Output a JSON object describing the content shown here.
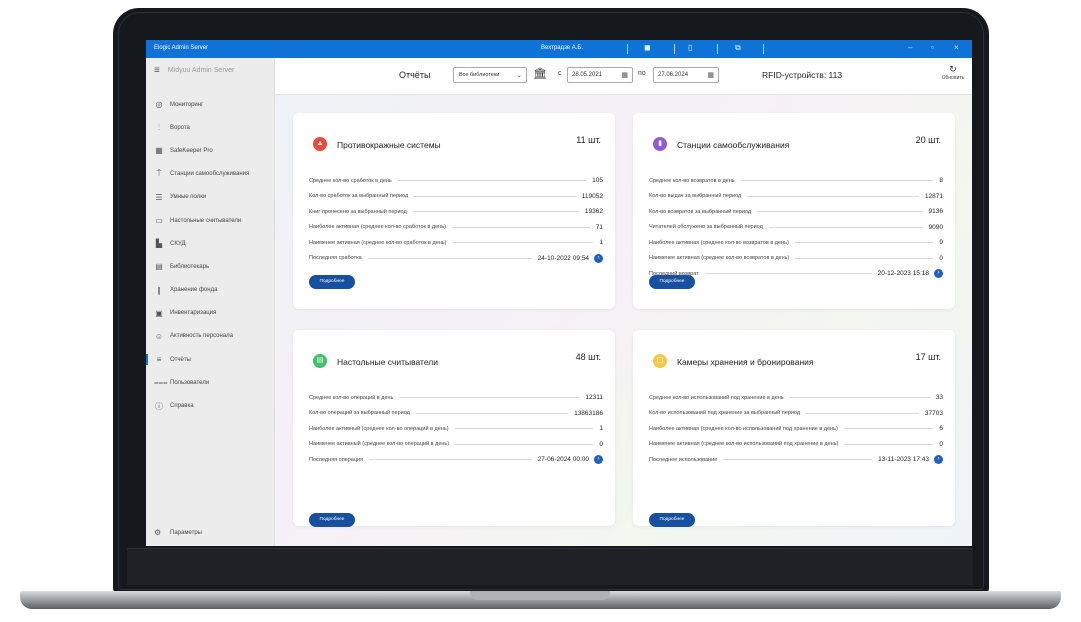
{
  "titlebar": {
    "app_title": "Elogic Admin Server",
    "user": "Вехтрадзе А.Б."
  },
  "sidebar": {
    "header": "Midyuu Admin Server",
    "items": [
      {
        "icon": "monitor-icon",
        "label": "Мониторинг"
      },
      {
        "icon": "gate-icon",
        "label": "Ворота"
      },
      {
        "icon": "safe-icon",
        "label": "SafeKeeper Pro"
      },
      {
        "icon": "kiosk-icon",
        "label": "Станции самообслуживания"
      },
      {
        "icon": "shelf-icon",
        "label": "Умные полки"
      },
      {
        "icon": "reader-icon",
        "label": "Настольные считыватели"
      },
      {
        "icon": "access-icon",
        "label": "СКУД"
      },
      {
        "icon": "librarian-icon",
        "label": "Библиотекарь"
      },
      {
        "icon": "storage-icon",
        "label": "Хранение фонда"
      },
      {
        "icon": "inventory-icon",
        "label": "Инвентаризация"
      },
      {
        "icon": "activity-icon",
        "label": "Активность персонала"
      },
      {
        "icon": "reports-icon",
        "label": "Отчёты"
      },
      {
        "icon": "users-icon",
        "label": "Пользователи"
      },
      {
        "icon": "help-icon",
        "label": "Справка"
      }
    ],
    "settings": "Параметры"
  },
  "toolbar": {
    "title": "Отчёты",
    "library_select": "Все библиотеки",
    "from_label": "с",
    "date_from": "28.05.2021",
    "to_label": "по",
    "date_to": "27.06.2024",
    "rfid": "RFID-устройств: 113",
    "refresh": "Обновить"
  },
  "cards": [
    {
      "title": "Противокражные системы",
      "count": "11 шт.",
      "color": "#e74c3c",
      "rows": [
        {
          "k": "Среднее кол-во сработок в день",
          "v": "105"
        },
        {
          "k": "Кол-во сработок за выбранный период",
          "v": "119052"
        },
        {
          "k": "Книг пронесено за выбранный период",
          "v": "19362"
        },
        {
          "k": "Наиболее активная (среднее кол-во сработок в день)",
          "v": "71"
        },
        {
          "k": "Наименее активная (среднее кол-во сработок в день)",
          "v": "1"
        },
        {
          "k": "Последняя сработка",
          "v": "24-10-2022 09:54"
        }
      ],
      "button": "Подробнее"
    },
    {
      "title": "Станции самообслуживания",
      "count": "20 шт.",
      "color": "#8e5bd6",
      "rows": [
        {
          "k": "Среднее кол-во возвратов в день",
          "v": "8"
        },
        {
          "k": "Кол-во выдач за выбранный период",
          "v": "12871"
        },
        {
          "k": "Кол-во возвратов за выбранный период",
          "v": "9136"
        },
        {
          "k": "Читателей обслужено за выбранный период",
          "v": "9090"
        },
        {
          "k": "Наиболее активная (среднее кол-во возвратов в день)",
          "v": "9"
        },
        {
          "k": "Наименее активная (среднее кол-во возвратов в день)",
          "v": "0"
        },
        {
          "k": "Последний возврат",
          "v": "20-12-2023 15:18"
        }
      ],
      "button": "Подробнее"
    },
    {
      "title": "Настольные считыватели",
      "count": "48 шт.",
      "color": "#43c06b",
      "rows": [
        {
          "k": "Среднее кол-во операций в день",
          "v": "12311"
        },
        {
          "k": "Кол-во операций за выбранный период",
          "v": "13863186"
        },
        {
          "k": "Наиболее активный (среднее кол-во операций в день)",
          "v": "1"
        },
        {
          "k": "Наименее активный (среднее кол-во операций в день)",
          "v": "0"
        },
        {
          "k": "Последняя операция",
          "v": "27-06-2024 00:00"
        }
      ],
      "button": "Подробнее"
    },
    {
      "title": "Камеры хранения и бронирования",
      "count": "17 шт.",
      "color": "#f2c94c",
      "rows": [
        {
          "k": "Среднее кол-во использований под хранение в день",
          "v": "33"
        },
        {
          "k": "Кол-во использований под хранение за выбранный период",
          "v": "37703"
        },
        {
          "k": "Наиболее активная (среднее кол-во использований под хранение в день)",
          "v": "6"
        },
        {
          "k": "Наименее активная (среднее кол-во использований под хранение в день)",
          "v": "0"
        },
        {
          "k": "Последнее использование",
          "v": "13-11-2023 17:43"
        }
      ],
      "button": "Подробнее"
    }
  ]
}
